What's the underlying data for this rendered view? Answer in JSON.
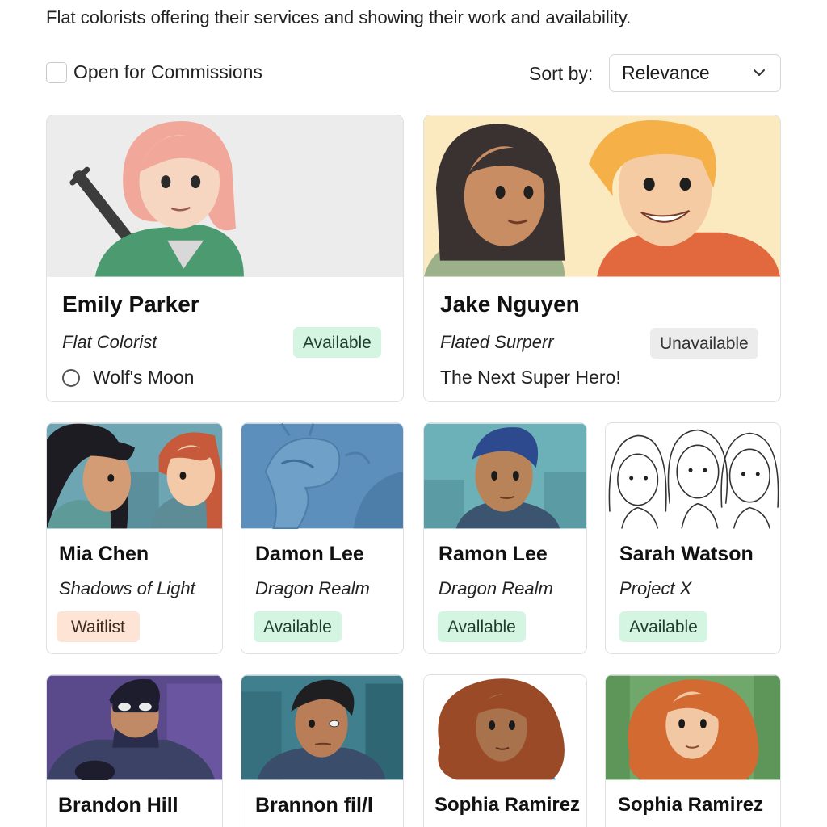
{
  "header": {
    "subtitle": "Flat colorists offering their services and showing their work and availability."
  },
  "filters": {
    "open_for_commissions": {
      "label": "Open for Commissions",
      "checked": false
    }
  },
  "sort": {
    "label": "Sort by:",
    "selected": "Relevance",
    "icon": "chevron-down-icon"
  },
  "colorists": [
    {
      "name": "Emily Parker",
      "role": "Flat Colorist",
      "status": "Available",
      "project": "Wolf's Moon"
    },
    {
      "name": "Jake Nguyen",
      "role": "Flated Surperr",
      "status": "Unavailable",
      "project": "The Next Super Hero!"
    },
    {
      "name": "Mia Chen",
      "role": "Shadows of Light",
      "status": "Waitlist"
    },
    {
      "name": "Damon Lee",
      "role": "Dragon Realm",
      "status": "Available"
    },
    {
      "name": "Ramon Lee",
      "role": "Dragon Realm",
      "status": "Avallable"
    },
    {
      "name": "Sarah Watson",
      "role": "Project X",
      "status": "Available"
    },
    {
      "name": "Brandon Hill"
    },
    {
      "name": "Brannon fil/l"
    },
    {
      "name": "Sophia Ramirez"
    },
    {
      "name": "Sophia Ramirez"
    }
  ],
  "colors": {
    "available_bg": "#d5f5e3",
    "unavailable_bg": "#ececec",
    "waitlist_bg": "#fde4d4",
    "border": "#e0e0e3"
  }
}
